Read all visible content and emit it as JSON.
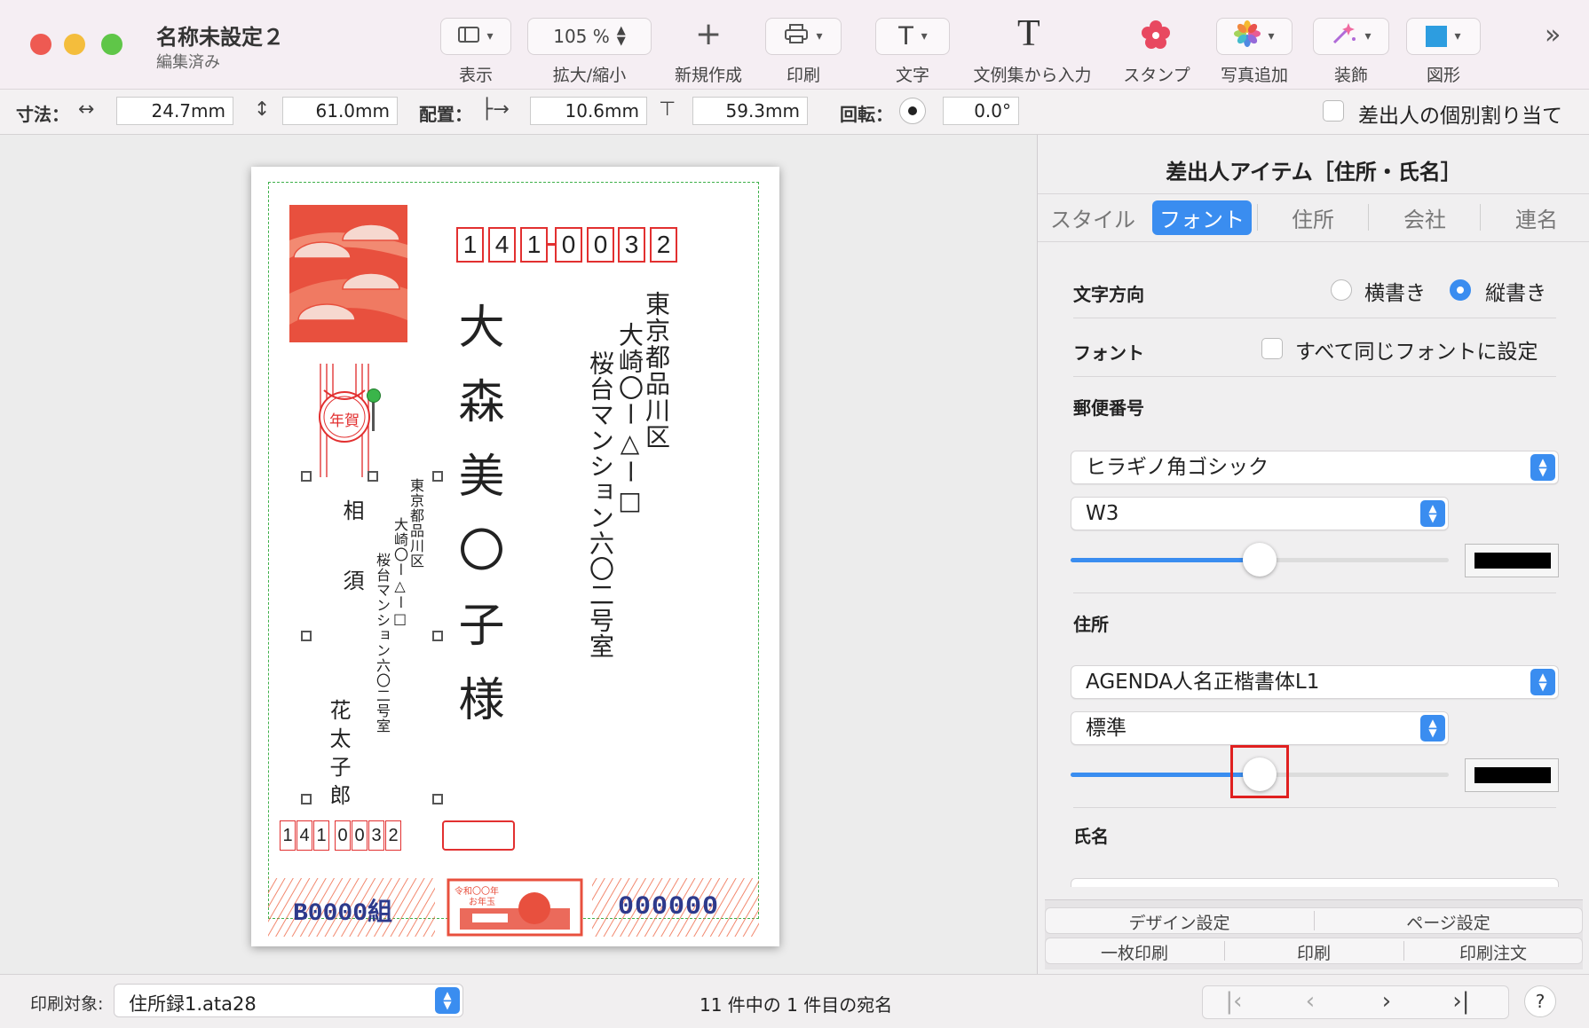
{
  "window": {
    "title": "名称未設定２",
    "subtitle": "編集済み"
  },
  "toolbar": {
    "view_label": "表示",
    "zoom_value": "105 %",
    "zoom_label": "拡大/縮小",
    "new_label": "新規作成",
    "print_label": "印刷",
    "text_label": "文字",
    "template_text_label": "文例集から入力",
    "stamp_label": "スタンプ",
    "photo_label": "写真追加",
    "decor_label": "装飾",
    "shape_label": "図形",
    "shape_color": "#2d9de0"
  },
  "dimbar": {
    "size_label": "寸法：",
    "width": "24.7mm",
    "height": "61.0mm",
    "position_label": "配置：",
    "x": "10.6mm",
    "y": "59.3mm",
    "rotation_label": "回転：",
    "rotation": "0.0°",
    "individual_label": "差出人の個別割り当て"
  },
  "card": {
    "recipient_zip_digits": [
      "1",
      "4",
      "1",
      "0",
      "0",
      "3",
      "2"
    ],
    "recipient_address_line1": "東京都品川区",
    "recipient_address_line2": "大崎〇ー△ー□",
    "recipient_address_line3": "桜台マンション六〇二号室",
    "recipient_name": "大森美〇子様",
    "sender_address_line1": "東京都品川区",
    "sender_address_line2": "大崎〇ー△ー□",
    "sender_address_line3": "桜台マンション六〇二号室",
    "sender_name1": "相須",
    "sender_name2": "花太子郎",
    "sender_zip_digits": [
      "1",
      "4",
      "1",
      "0",
      "0",
      "3",
      "2"
    ],
    "stamp_text": "年賀",
    "lottery_group": "B0000組",
    "lottery_number": "000000",
    "lottery_center_line1": "令和〇〇年",
    "lottery_center_line2": "お年玉",
    "accent_color": "#e23030"
  },
  "panel": {
    "title": "差出人アイテム［住所・氏名］",
    "tabs": [
      "スタイル",
      "フォント",
      "住所",
      "会社",
      "連名"
    ],
    "active_tab": "フォント",
    "text_direction_label": "文字方向",
    "horizontal_label": "横書き",
    "vertical_label": "縦書き",
    "font_label": "フォント",
    "same_font_label": "すべて同じフォントに設定",
    "zip_section": "郵便番号",
    "zip_font": "ヒラギノ角ゴシック",
    "zip_weight": "W3",
    "zip_size_fraction": 0.5,
    "address_section": "住所",
    "address_font": "AGENDA人名正楷書体L1",
    "address_weight": "標準",
    "address_size_fraction": 0.5,
    "name_section": "氏名",
    "design_settings": "デザイン設定",
    "page_settings": "ページ設定",
    "single_print": "一枚印刷",
    "print": "印刷",
    "print_order": "印刷注文",
    "accent_color": "#3a8df0"
  },
  "bottom": {
    "print_target_label": "印刷対象:",
    "print_target_value": "住所録1.ata28",
    "record_status": "11 件中の 1 件目の宛名",
    "help": "?"
  }
}
